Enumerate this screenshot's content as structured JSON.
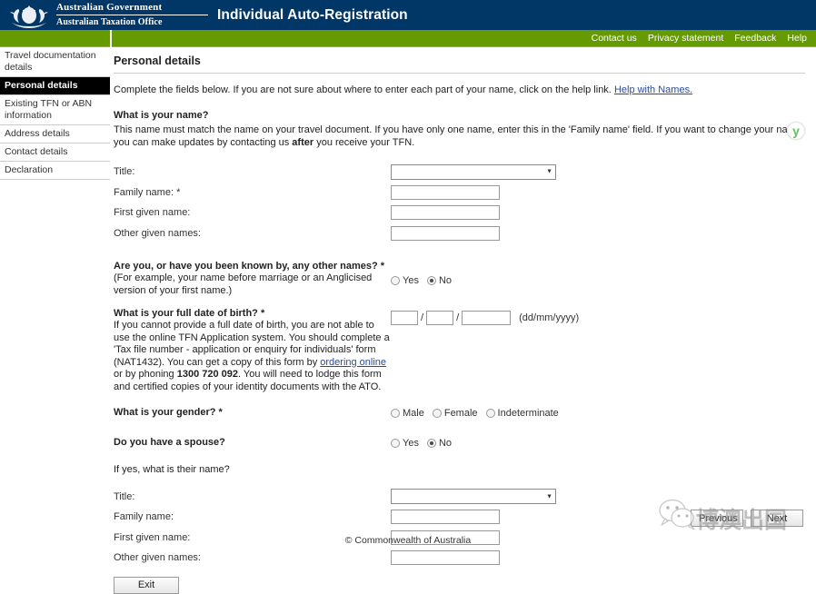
{
  "header": {
    "gov_line1": "Australian Government",
    "gov_line2": "Australian Taxation Office",
    "app_title": "Individual Auto-Registration",
    "crest_icon": "australian-coat-of-arms"
  },
  "topnav": {
    "links": [
      {
        "label": "Contact us"
      },
      {
        "label": "Privacy statement"
      },
      {
        "label": "Feedback"
      },
      {
        "label": "Help"
      }
    ]
  },
  "sidebar": {
    "items": [
      {
        "label": "Travel documentation details",
        "active": false
      },
      {
        "label": "Personal details",
        "active": true
      },
      {
        "label": "Existing TFN or ABN information",
        "active": false
      },
      {
        "label": "Address details",
        "active": false
      },
      {
        "label": "Contact details",
        "active": false
      },
      {
        "label": "Declaration",
        "active": false
      }
    ]
  },
  "main": {
    "page_title": "Personal details",
    "intro_text": "Complete the fields below. If you are not sure about where to enter each part of your name, click on the help link. ",
    "intro_link": "Help with Names.",
    "name_question": {
      "heading": "What is your name?",
      "body_part1": "This name must match the name on your travel document. If you have only one name, enter this in the 'Family name' field. If you want to change your name, you can make updates by contacting us ",
      "body_bold": "after",
      "body_part2": " you receive your TFN.",
      "fields": [
        {
          "label": "Title:",
          "type": "select",
          "value": ""
        },
        {
          "label": "Family name: *",
          "type": "text",
          "value": ""
        },
        {
          "label": "First given name:",
          "type": "text",
          "value": ""
        },
        {
          "label": "Other given names:",
          "type": "text",
          "value": ""
        }
      ]
    },
    "other_names_question": {
      "heading": "Are you, or have you been known by, any other names? *",
      "body": "(For example, your name before marriage or an Anglicised version of your first name.)",
      "options": [
        {
          "label": "Yes",
          "selected": false
        },
        {
          "label": "No",
          "selected": true
        }
      ]
    },
    "dob_question": {
      "heading": "What is your full date of birth? *",
      "body_part1": "If you cannot provide a full date of birth, you are not able to use the online TFN Application system. You should complete a 'Tax file number - application or enquiry for individuals' form (NAT1432). You can get a copy of this form by ",
      "body_link": "ordering online",
      "body_part2": " or by phoning ",
      "body_phone": "1300 720 092",
      "body_part3": ". You will need to lodge this form and certified copies of your identity documents with the ATO.",
      "day_value": "",
      "month_value": "",
      "year_value": "",
      "separator": "/",
      "format_hint": "(dd/mm/yyyy)"
    },
    "gender_question": {
      "heading": "What is your gender? *",
      "options": [
        {
          "label": "Male",
          "selected": false
        },
        {
          "label": "Female",
          "selected": false
        },
        {
          "label": "Indeterminate",
          "selected": false
        }
      ]
    },
    "spouse_question": {
      "heading": "Do you have a spouse?",
      "subheading": "If yes, what is their name?",
      "options": [
        {
          "label": "Yes",
          "selected": false
        },
        {
          "label": "No",
          "selected": true
        }
      ],
      "fields": [
        {
          "label": "Title:",
          "type": "select",
          "value": ""
        },
        {
          "label": "Family name:",
          "type": "text",
          "value": ""
        },
        {
          "label": "First given name:",
          "type": "text",
          "value": ""
        },
        {
          "label": "Other given names:",
          "type": "text",
          "value": ""
        }
      ]
    },
    "buttons": {
      "exit": "Exit",
      "previous": "Previous",
      "next": "Next"
    }
  },
  "badge": {
    "icon": "green-y-logo",
    "label": "y"
  },
  "watermark": {
    "icon": "wechat-icon",
    "text": "博澳出国"
  },
  "footer": {
    "copyright": "© Commonwealth of Australia"
  },
  "colors": {
    "header_navy": "#003767",
    "nav_green": "#659b01",
    "active_item": "#000000",
    "link_blue": "#2a4b9b",
    "badge_green": "#5ec45e"
  }
}
